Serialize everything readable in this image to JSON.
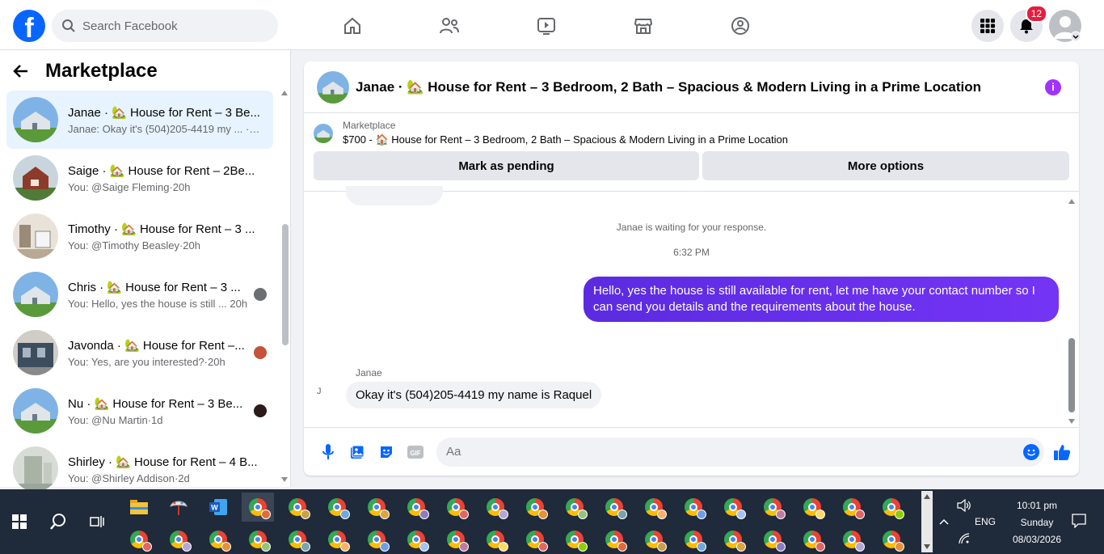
{
  "topbar": {
    "logo": "f",
    "search_placeholder": "Search Facebook",
    "notification_count": "12",
    "icons": [
      "home-icon",
      "friends-icon",
      "video-icon",
      "marketplace-icon",
      "groups-icon",
      "menu-grid-icon",
      "bell-icon",
      "avatar"
    ]
  },
  "sidebar": {
    "title": "Marketplace",
    "conversations": [
      {
        "title": "Janae · 🏡 House for Rent – 3 Be...",
        "subtitle": "Janae: Okay it's (504)205-4419 my ... ·2m"
      },
      {
        "title": "Saige · 🏡 House for Rent – 2Be...",
        "subtitle": "You: @Saige Fleming·20h"
      },
      {
        "title": "Timothy · 🏡 House for Rent – 3 ...",
        "subtitle": "You: @Timothy Beasley·20h"
      },
      {
        "title": "Chris · 🏡 House for Rent – 3 ...",
        "subtitle": "You: Hello, yes the house is still ... 20h"
      },
      {
        "title": "Javonda · 🏡 House for Rent –...",
        "subtitle": "You: Yes, are you interested?·20h"
      },
      {
        "title": "Nu · 🏡 House for Rent – 3 Be...",
        "subtitle": "You: @Nu Martin·1d"
      },
      {
        "title": "Shirley · 🏡 House for Rent – 4 B...",
        "subtitle": "You: @Shirley Addison·2d"
      }
    ]
  },
  "chat": {
    "header_title": "Janae · 🏡 House for Rent – 3 Bedroom, 2 Bath – Spacious & Modern Living in a Prime Location",
    "marketplace_label": "Marketplace",
    "listing": "$700 - 🏠 House for Rent – 3 Bedroom, 2 Bath – Spacious & Modern Living in a Prime Location",
    "mark_pending": "Mark as pending",
    "more_options": "More options",
    "waiting": "Janae is waiting for your response.",
    "time": "6:32 PM",
    "outgoing": "Hello, yes the house is still available for rent, let me have your contact number so I can send you details and the requirements about the house.",
    "sender": "Janae",
    "incoming": "Okay it's (504)205-4419 my name is Raquel",
    "input_placeholder": "Aa",
    "avatar_alt": "J"
  },
  "taskbar": {
    "time": "10:01 pm",
    "day": "Sunday",
    "date": "08/03/2026",
    "lang": "ENG"
  }
}
